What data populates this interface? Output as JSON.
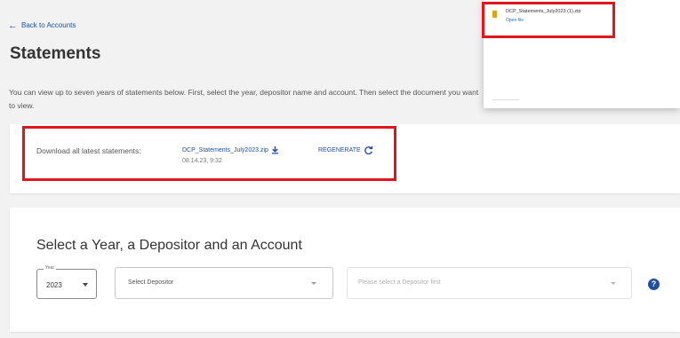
{
  "nav": {
    "back_label": "Back to Accounts"
  },
  "page": {
    "title": "Statements",
    "intro": "You can view up to seven years of statements below. First, select the year, depositor name and account. Then select the document you want to view."
  },
  "download": {
    "label": "Download all latest statements:",
    "file_name": "DCP_Statements_July2023.zip",
    "timestamp": "08.14.23, 9:32",
    "regenerate_label": "REGENERATE"
  },
  "selector": {
    "heading": "Select a Year, a Depositor and an Account",
    "year": {
      "label": "Year",
      "value": "2023"
    },
    "depositor": {
      "placeholder": "Select Depositor"
    },
    "account": {
      "placeholder": "Please select a Depositor first"
    }
  },
  "browser_download": {
    "file_name": "DCP_Statements_July2023 (1).zip",
    "open_label": "Open file"
  },
  "colors": {
    "link": "#1f4f9e",
    "highlight": "#e3141b",
    "help_icon": "#1f4f9e"
  }
}
